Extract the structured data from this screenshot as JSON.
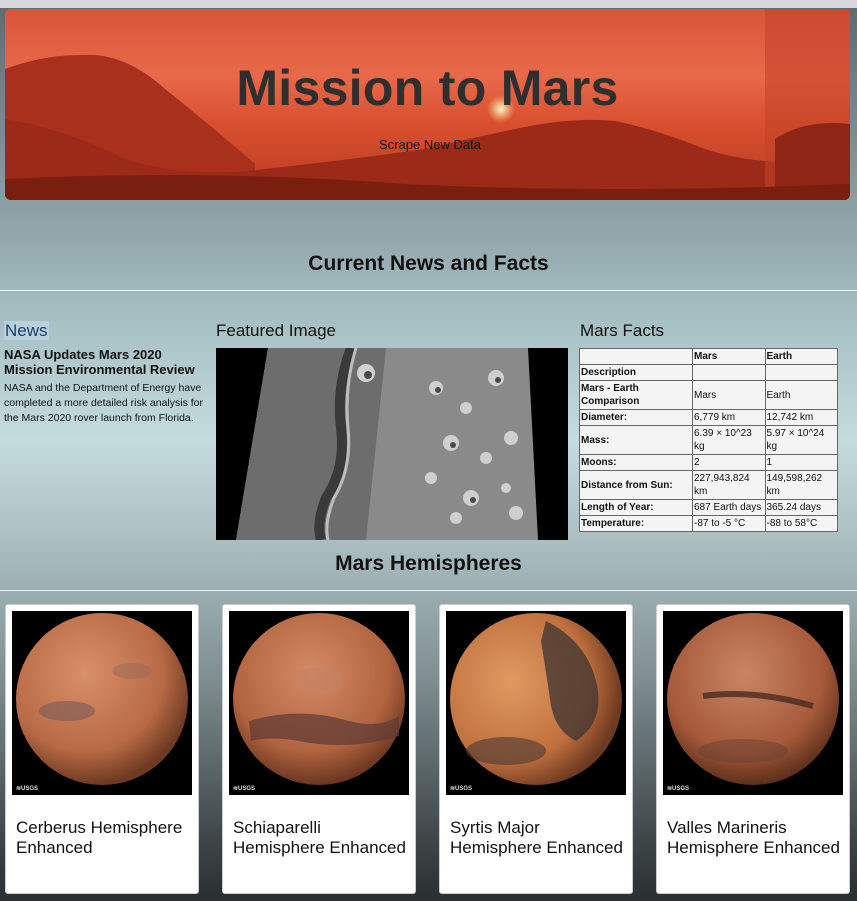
{
  "header": {
    "title": "Mission to Mars",
    "scrape_button": "Scrape New Data"
  },
  "sections": {
    "news_facts_title": "Current News and Facts",
    "hemispheres_title": "Mars Hemispheres"
  },
  "news": {
    "heading": "News",
    "title": "NASA Updates Mars 2020 Mission Environmental Review",
    "body": "NASA and the Department of Energy have completed a more detailed risk analysis for the Mars 2020 rover launch from Florida."
  },
  "featured": {
    "heading": "Featured Image"
  },
  "facts": {
    "heading": "Mars Facts",
    "columns": [
      "",
      "Mars",
      "Earth"
    ],
    "rows": [
      {
        "label": "Description",
        "mars": "",
        "earth": ""
      },
      {
        "label": "Mars - Earth Comparison",
        "mars": "Mars",
        "earth": "Earth"
      },
      {
        "label": "Diameter:",
        "mars": "6,779 km",
        "earth": "12,742 km"
      },
      {
        "label": "Mass:",
        "mars": "6.39 × 10^23 kg",
        "earth": "5.97 × 10^24 kg"
      },
      {
        "label": "Moons:",
        "mars": "2",
        "earth": "1"
      },
      {
        "label": "Distance from Sun:",
        "mars": "227,943,824 km",
        "earth": "149,598,262 km"
      },
      {
        "label": "Length of Year:",
        "mars": "687 Earth days",
        "earth": "365.24 days"
      },
      {
        "label": "Temperature:",
        "mars": "-87 to -5 °C",
        "earth": "-88 to 58°C"
      }
    ]
  },
  "hemispheres": [
    {
      "caption": "Cerberus Hemisphere Enhanced",
      "logo": "≋USGS"
    },
    {
      "caption": "Schiaparelli Hemisphere Enhanced",
      "logo": "≋USGS"
    },
    {
      "caption": "Syrtis Major Hemisphere Enhanced",
      "logo": "≋USGS"
    },
    {
      "caption": "Valles Marineris Hemisphere Enhanced",
      "logo": "≋USGS"
    }
  ],
  "colors": {
    "hero_red": "#d9553a",
    "mars_orange": "#c0643a",
    "news_blue": "#1f3c7a"
  }
}
